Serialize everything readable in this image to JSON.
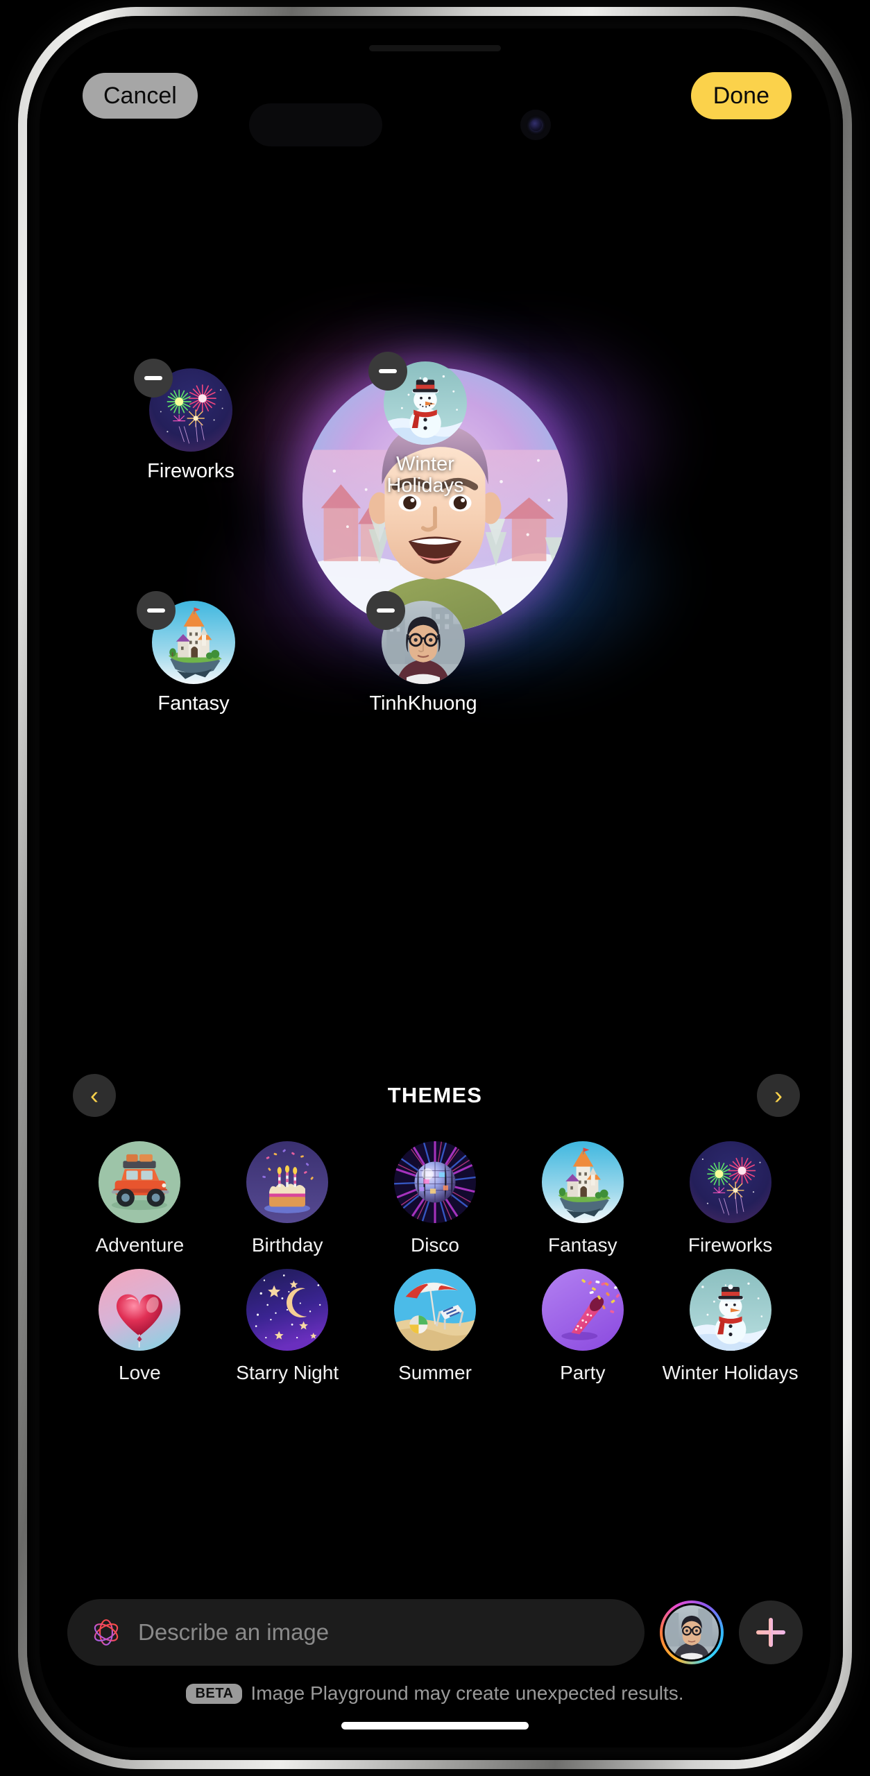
{
  "app": {
    "name": "Image Playground",
    "accent_yellow": "#fbd24b",
    "background": "#000000"
  },
  "topbar": {
    "cancel_label": "Cancel",
    "done_label": "Done"
  },
  "canvas": {
    "main_image_alt": "generated-portrait",
    "concepts": [
      {
        "label": "Fireworks",
        "icon": "fireworks-icon",
        "remove_label": "remove"
      },
      {
        "label": "Winter\nHolidays",
        "icon": "snowman-icon",
        "remove_label": "remove"
      },
      {
        "label": "Fantasy",
        "icon": "castle-icon",
        "remove_label": "remove"
      },
      {
        "label": "TinhKhuong",
        "icon": "person-photo",
        "remove_label": "remove"
      }
    ]
  },
  "themes": {
    "title": "THEMES",
    "prev_icon": "chevron-left-icon",
    "next_icon": "chevron-right-icon",
    "items": [
      {
        "label": "Adventure",
        "icon": "jeep-icon"
      },
      {
        "label": "Birthday",
        "icon": "cake-icon"
      },
      {
        "label": "Disco",
        "icon": "disco-ball-icon"
      },
      {
        "label": "Fantasy",
        "icon": "castle-icon"
      },
      {
        "label": "Fireworks",
        "icon": "fireworks-icon"
      },
      {
        "label": "Love",
        "icon": "heart-balloon-icon"
      },
      {
        "label": "Starry Night",
        "icon": "moon-stars-icon"
      },
      {
        "label": "Summer",
        "icon": "beach-icon"
      },
      {
        "label": "Party",
        "icon": "party-popper-icon"
      },
      {
        "label": "Winter Holidays",
        "icon": "snowman-icon"
      }
    ]
  },
  "composer": {
    "ai_icon": "apple-intelligence-icon",
    "placeholder": "Describe an image",
    "person_button_icon": "person-avatar",
    "add_button_icon": "plus-icon"
  },
  "disclaimer": {
    "badge": "BETA",
    "text": "Image Playground may create unexpected results."
  }
}
